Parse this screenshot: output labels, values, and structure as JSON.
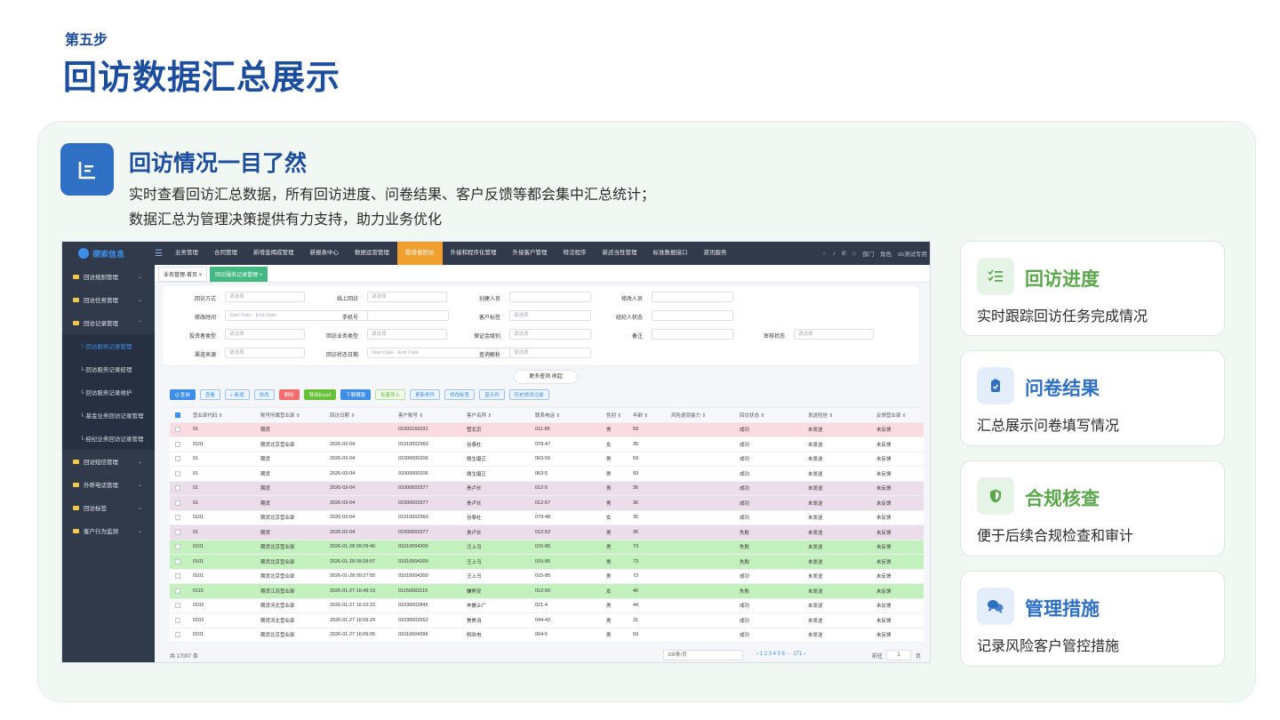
{
  "header": {
    "step": "第五步",
    "title": "回访数据汇总展示"
  },
  "section": {
    "title": "回访情况一目了然",
    "desc_line1": "实时查看回访汇总数据，所有回访进度、问卷结果、客户反馈等都会集中汇总统计；",
    "desc_line2": "数据汇总为管理决策提供有力支持，助力业务优化"
  },
  "app": {
    "logo": "德索信息",
    "nav": [
      "业务管理",
      "合同管理",
      "新增金揭成管理",
      "新报表中心",
      "数据运营管理",
      "投资者回访",
      "外接和程序化管理",
      "外接客户管理",
      "特法程序",
      "新适当性管理",
      "标准数据接口",
      "资讯服务"
    ],
    "nav_active": 5,
    "nav_right": [
      "部门",
      "角色",
      "ds测试专用"
    ],
    "sidebar": [
      {
        "label": "回访规则管理",
        "type": "group"
      },
      {
        "label": "回访任务管理",
        "type": "group"
      },
      {
        "label": "回访记录管理",
        "type": "group",
        "open": true
      },
      {
        "label": "└ 回访服务记录管理",
        "type": "sub",
        "active": true
      },
      {
        "label": "└ 回访服务记录经理",
        "type": "sub"
      },
      {
        "label": "└ 回访服务记录维护",
        "type": "sub"
      },
      {
        "label": "└ 基金业务回访记录管理",
        "type": "sub"
      },
      {
        "label": "└ 经纪业务回访记录管理",
        "type": "sub"
      },
      {
        "label": "回访短信管理",
        "type": "group"
      },
      {
        "label": "外呼电话管理",
        "type": "group"
      },
      {
        "label": "回访标签",
        "type": "group"
      },
      {
        "label": "客户行为监测",
        "type": "group"
      }
    ],
    "tabs": [
      {
        "label": "业务管理-首页 ×"
      },
      {
        "label": "回访服务记录管理 ×",
        "active": true
      }
    ],
    "filters": [
      [
        {
          "label": "回访方式",
          "ph": "请选择"
        },
        {
          "label": "线上回访",
          "ph": "请选择"
        },
        {
          "label": "创建人员",
          "ph": ""
        },
        {
          "label": "修改人员",
          "ph": ""
        }
      ],
      [
        {
          "label": "修改时间",
          "ph": "Start Date     -     End Date"
        },
        {
          "label": "手机号",
          "ph": ""
        },
        {
          "label": "客户标签",
          "ph": "请选择"
        },
        {
          "label": "经纪人状态",
          "ph": ""
        }
      ],
      [
        {
          "label": "投资者类型",
          "ph": "请选择"
        },
        {
          "label": "回访业务类型",
          "ph": "请选择"
        },
        {
          "label": "保证金级别",
          "ph": "请选择"
        },
        {
          "label": "备注",
          "ph": ""
        },
        {
          "label": "审核状态",
          "ph": "请选择"
        }
      ],
      [
        {
          "label": "渠道来源",
          "ph": "请选择"
        },
        {
          "label": "回访状态日期",
          "ph": "Start Date     -     End Date"
        },
        {
          "label": "查询解析",
          "ph": "请选择"
        }
      ]
    ],
    "more": "更多查询  收起",
    "buttons": [
      {
        "label": "Q 查询",
        "style": "blue"
      },
      {
        "label": "查看",
        "style": ""
      },
      {
        "label": "+ 新增",
        "style": ""
      },
      {
        "label": "修改",
        "style": ""
      },
      {
        "label": "删除",
        "style": "red"
      },
      {
        "label": "导出Excel",
        "style": "green"
      },
      {
        "label": "下载模版",
        "style": "blue"
      },
      {
        "label": "批量导入",
        "style": "lg"
      },
      {
        "label": "更新条件",
        "style": ""
      },
      {
        "label": "修改标签",
        "style": ""
      },
      {
        "label": "显示列",
        "style": ""
      },
      {
        "label": "历史修改记录",
        "style": ""
      }
    ],
    "columns": [
      "营业部代码 ⇕",
      "账号所属营业部 ⇕",
      "回访日期 ⇕",
      "客户账号 ⇕",
      "客户名称 ⇕",
      "联系电话 ⇕",
      "性别 ⇕",
      "年龄 ⇕",
      "风险承受能力 ⇕",
      "回访状态 ⇕",
      "发送短信 ⇕",
      "反馈营业部 ⇕"
    ],
    "rows": [
      {
        "c": [
          "01",
          "期货",
          "",
          "01000169331",
          "管北京",
          "011-85",
          "男",
          "59",
          "",
          "成功",
          "未发送",
          "未反馈"
        ],
        "bg": "pink"
      },
      {
        "c": [
          "0101",
          "期货北京营业部",
          "2026-03-04",
          "01010002960",
          "谷泰杜",
          "079-47",
          "女",
          "35",
          "",
          "成功",
          "未发送",
          "未反馈"
        ],
        "bg": ""
      },
      {
        "c": [
          "01",
          "期货",
          "2026-03-04",
          "01000000206",
          "微生磨正",
          "063-55",
          "男",
          "59",
          "",
          "成功",
          "未发送",
          "未反馈"
        ],
        "bg": ""
      },
      {
        "c": [
          "01",
          "期货",
          "2026-03-04",
          "01000000206",
          "微生磨正",
          "063-5",
          "男",
          "59",
          "",
          "成功",
          "未发送",
          "未反馈"
        ],
        "bg": ""
      },
      {
        "c": [
          "01",
          "期货",
          "2026-03-04",
          "01000003377",
          "贵卢长",
          "012-5",
          "男",
          "36",
          "",
          "成功",
          "未发送",
          "未反馈"
        ],
        "bg": "purple"
      },
      {
        "c": [
          "01",
          "期货",
          "2026-03-04",
          "01000003377",
          "贵卢长",
          "012-57",
          "男",
          "36",
          "",
          "成功",
          "未发送",
          "未反馈"
        ],
        "bg": "purple"
      },
      {
        "c": [
          "0101",
          "期货北京营业部",
          "2026-03-04",
          "01010002960",
          "谷泰杜",
          "079-48",
          "女",
          "35",
          "",
          "成功",
          "未发送",
          "未反馈"
        ],
        "bg": ""
      },
      {
        "c": [
          "01",
          "期货",
          "2026-02-04",
          "01000003377",
          "贵卢长",
          "012-52",
          "男",
          "36",
          "",
          "失败",
          "未发送",
          "未反馈"
        ],
        "bg": "purple"
      },
      {
        "c": [
          "0101",
          "期货北京营业部",
          "2026-01-28 09:29:40",
          "01010004300",
          "汪上乌",
          "015-85",
          "男",
          "73",
          "",
          "失败",
          "未发送",
          "未反馈"
        ],
        "bg": "green"
      },
      {
        "c": [
          "0101",
          "期货北京营业部",
          "2026-01-28 09:28:07",
          "01010004300",
          "汪上乌",
          "015-85",
          "男",
          "73",
          "",
          "失败",
          "未发送",
          "未反馈"
        ],
        "bg": "green"
      },
      {
        "c": [
          "0101",
          "期货北京营业部",
          "2026-01-28 09:27:05",
          "01010004300",
          "汪上乌",
          "015-85",
          "男",
          "73",
          "",
          "成功",
          "未发送",
          "未反馈"
        ],
        "bg": ""
      },
      {
        "c": [
          "0115",
          "期货江苏营业部",
          "2026-01-27 16:49:19",
          "01150003119",
          "嫌熊安",
          "012-50",
          "女",
          "40",
          "",
          "失败",
          "未发送",
          "未反馈"
        ],
        "bg": "green"
      },
      {
        "c": [
          "0103",
          "期货河北营业部",
          "2026-01-27 16:10:23",
          "01030002845",
          "申屠止广",
          "021-4",
          "男",
          "44",
          "",
          "成功",
          "未发送",
          "未反馈"
        ],
        "bg": ""
      },
      {
        "c": [
          "0103",
          "期货河北营业部",
          "2026-01-27 16:09:29",
          "01030002552",
          "焦焦羽",
          "044-42",
          "男",
          "31",
          "",
          "成功",
          "未发送",
          "未反馈"
        ],
        "bg": ""
      },
      {
        "c": [
          "0101",
          "期货北京营业部",
          "2026-01-27 16:09:05",
          "01010004396",
          "斜欢电",
          "064-5",
          "男",
          "59",
          "",
          "成功",
          "未发送",
          "未反馈"
        ],
        "bg": ""
      }
    ],
    "total": "共 17007 条",
    "page_size": "100条/页",
    "pages": "‹  1  2  3  4  5  6  ···  171  ›",
    "goto": "前往",
    "goto_page": "1",
    "goto_unit": "页"
  },
  "cards": [
    {
      "title": "回访进度",
      "desc": "实时跟踪回访任务完成情况",
      "icon": "checklist-icon",
      "color": "#5aa84a",
      "bg": "#e6f4e8"
    },
    {
      "title": "问卷结果",
      "desc": "汇总展示问卷填写情况",
      "icon": "clipboard-icon",
      "color": "#2f6fc4",
      "bg": "#e4eefa"
    },
    {
      "title": "合规核查",
      "desc": "便于后续合规检查和审计",
      "icon": "shield-icon",
      "color": "#5aa84a",
      "bg": "#e6f4e8"
    },
    {
      "title": "管理措施",
      "desc": "记录风险客户管控措施",
      "icon": "chat-icon",
      "color": "#2f6fc4",
      "bg": "#e4eefa"
    }
  ]
}
